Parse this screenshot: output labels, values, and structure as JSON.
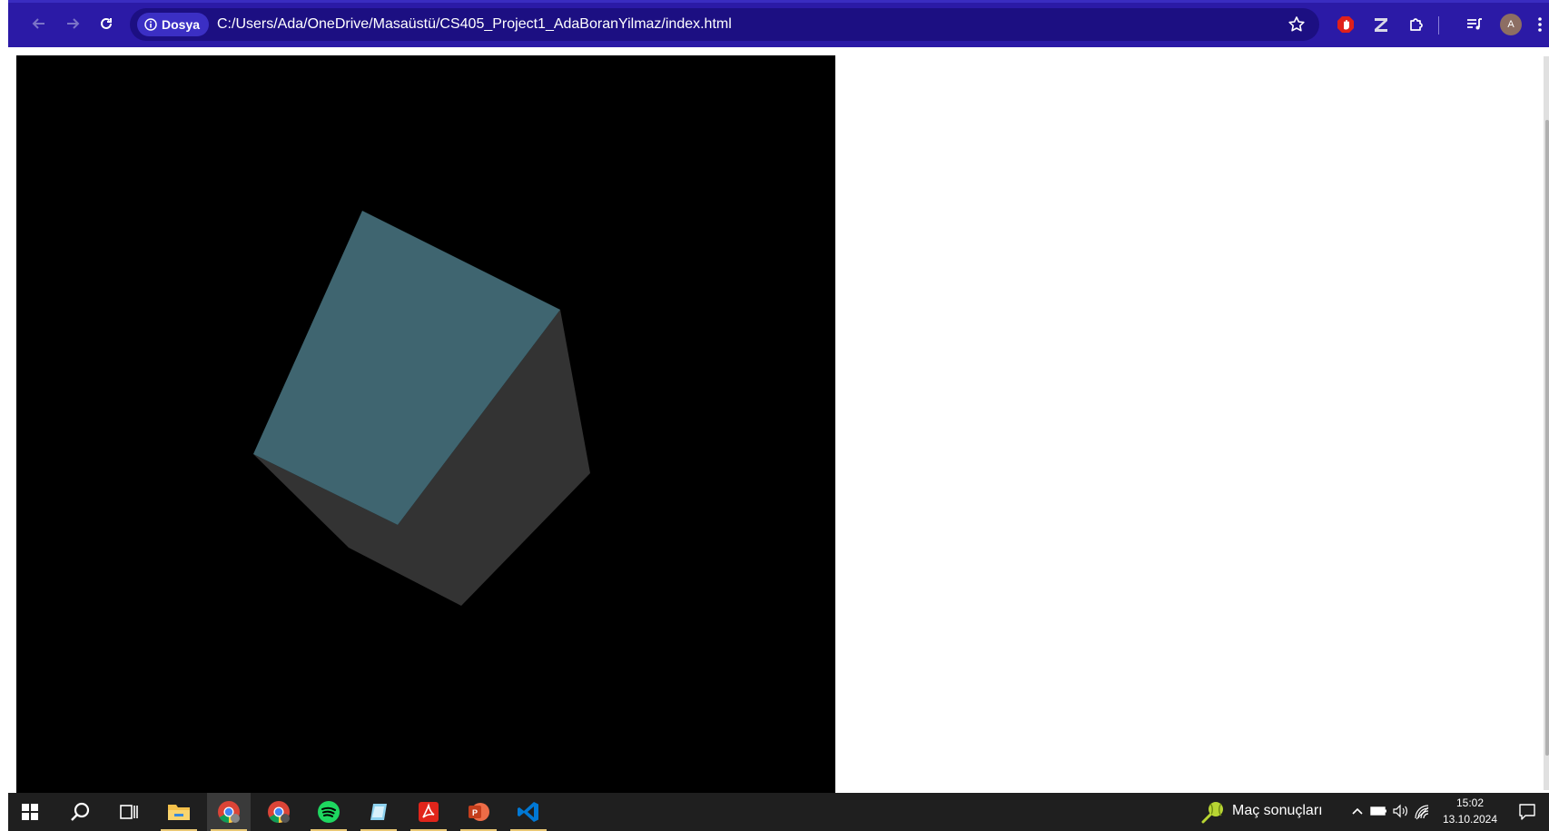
{
  "browser": {
    "back_icon": "arrow-left-icon",
    "forward_icon": "arrow-right-icon",
    "reload_icon": "reload-icon",
    "security_chip_label": "Dosya",
    "url": "C:/Users/Ada/OneDrive/Masaüstü/CS405_Project1_AdaBoranYilmaz/index.html",
    "bookmark_icon": "star-icon",
    "extensions": [
      "adblock-icon",
      "z-extension-icon",
      "puzzle-icon"
    ],
    "media_icon": "media-queue-icon",
    "profile_initial": "A",
    "menu_icon": "kebab-menu-icon",
    "colors": {
      "toolbar": "#2b1aa6",
      "omnibox": "#1c0f82"
    }
  },
  "canvas": {
    "background": "#000000",
    "cube_top_color": "#3f6570",
    "cube_side_color": "#333333"
  },
  "taskbar": {
    "apps": [
      {
        "name": "start-icon"
      },
      {
        "name": "search-icon"
      },
      {
        "name": "task-view-icon"
      },
      {
        "name": "file-explorer-icon"
      },
      {
        "name": "chrome-icon"
      },
      {
        "name": "chrome-profile-icon"
      },
      {
        "name": "spotify-icon"
      },
      {
        "name": "notepad-icon"
      },
      {
        "name": "acrobat-icon"
      },
      {
        "name": "powerpoint-icon"
      },
      {
        "name": "vscode-icon"
      }
    ],
    "widget_label": "Maç sonuçları",
    "time": "15:02",
    "date": "13.10.2024"
  }
}
